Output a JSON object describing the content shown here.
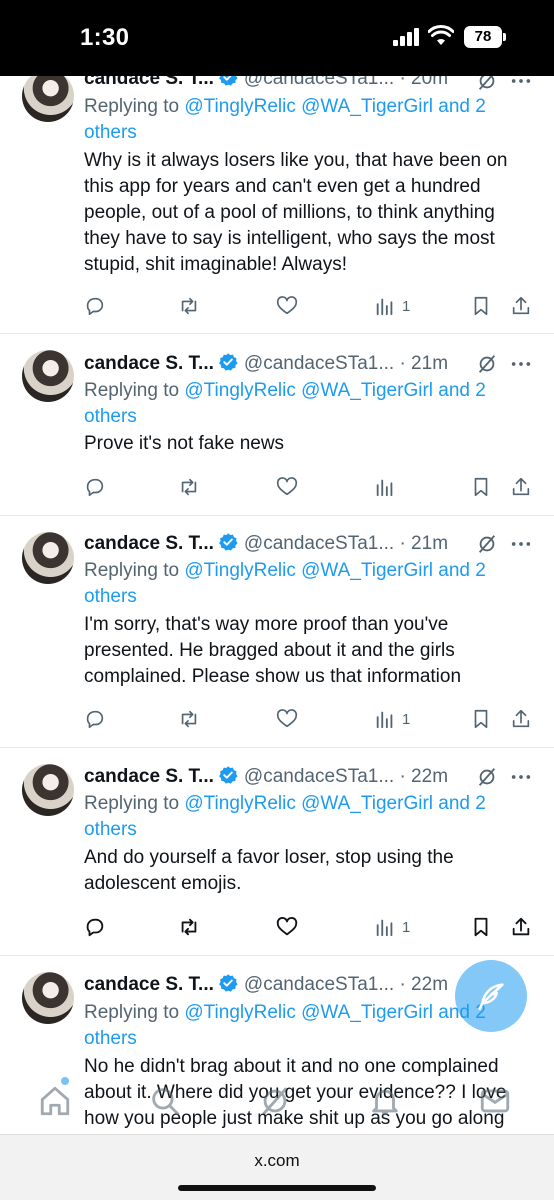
{
  "status_bar": {
    "time": "1:30",
    "battery": "78"
  },
  "colors": {
    "accent": "#1d9bf0",
    "secondary_text": "#536471",
    "text": "#0f1419"
  },
  "tweets": [
    {
      "name": "candace S. T...",
      "handle": "@candaceSTa1...",
      "time": "· 20m",
      "reply_prefix": "Replying to ",
      "mentions": "@TinglyRelic @WA_TigerGirl and 2 others",
      "text": "Why is it always losers like you, that have been on this app for years and can't even get a hundred people, out of a pool of millions, to think anything they have to say is intelligent, who says the most stupid, shit imaginable! Always!",
      "views": "1"
    },
    {
      "name": "candace S. T...",
      "handle": "@candaceSTa1...",
      "time": "· 21m",
      "reply_prefix": "Replying to ",
      "mentions": "@TinglyRelic @WA_TigerGirl and 2 others",
      "text": "Prove it's not fake news",
      "views": ""
    },
    {
      "name": "candace S. T...",
      "handle": "@candaceSTa1...",
      "time": "· 21m",
      "reply_prefix": "Replying to ",
      "mentions": "@TinglyRelic @WA_TigerGirl and 2 others",
      "text": "I'm sorry, that's way more proof than you've presented. He bragged about it and the girls complained. Please show us that information",
      "views": "1"
    },
    {
      "name": "candace S. T...",
      "handle": "@candaceSTa1...",
      "time": "· 22m",
      "reply_prefix": "Replying to ",
      "mentions": "@TinglyRelic @WA_TigerGirl and 2 others",
      "text": "And do yourself a favor loser, stop using the adolescent emojis.",
      "views": "1"
    },
    {
      "name": "candace S. T...",
      "handle": "@candaceSTa1...",
      "time": "· 22m",
      "reply_prefix": "Replying to ",
      "mentions": "@TinglyRelic @WA_TigerGirl and 2 others",
      "text": "No he didn't brag about it and no one complained about it. Where did you get your evidence?? I love how you people just make shit up as you go along",
      "views": ""
    }
  ],
  "browser": {
    "url": "x.com"
  }
}
